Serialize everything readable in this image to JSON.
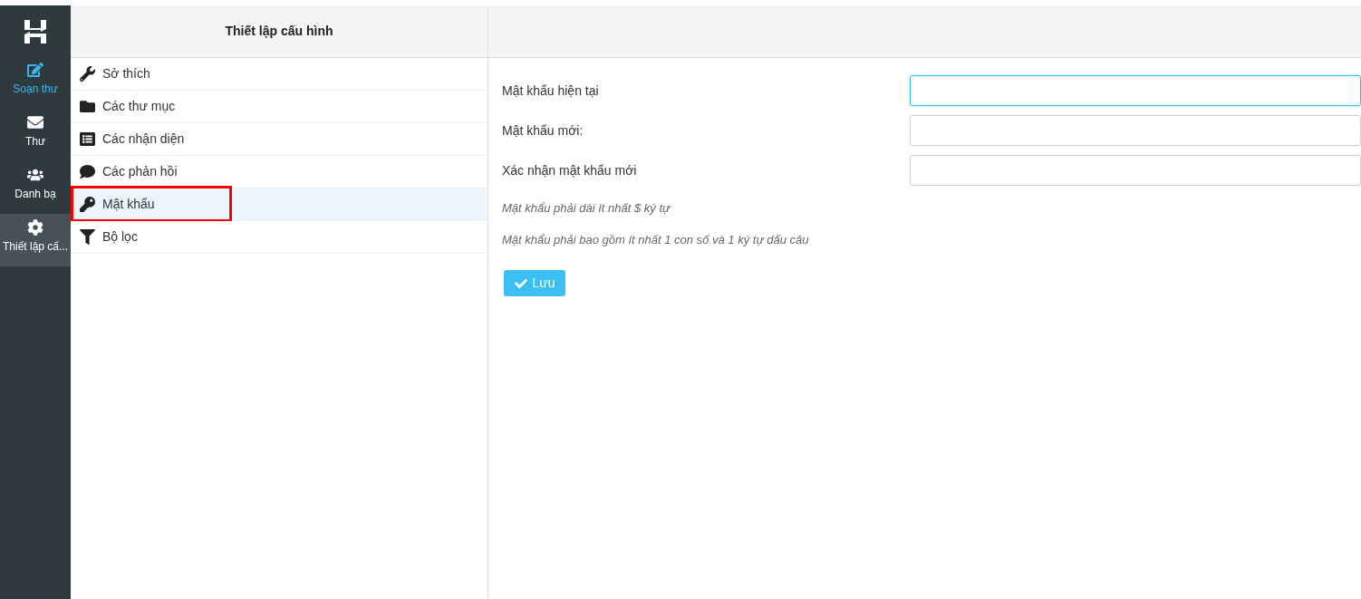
{
  "nav": [
    {
      "kind": "compose",
      "label": "Soạn thư",
      "accent": true,
      "selected": false
    },
    {
      "kind": "mail",
      "label": "Thư",
      "accent": false,
      "selected": false
    },
    {
      "kind": "contacts",
      "label": "Danh bạ",
      "accent": false,
      "selected": false
    },
    {
      "kind": "settings",
      "label": "Thiết lập cấ...",
      "accent": false,
      "selected": true
    }
  ],
  "settings": {
    "title": "Thiết lập cấu hình",
    "items": [
      {
        "kind": "wrench",
        "label": "Sở thích",
        "selected": false,
        "outlined": false
      },
      {
        "kind": "folder",
        "label": "Các thư mục",
        "selected": false,
        "outlined": false
      },
      {
        "kind": "list",
        "label": "Các nhận diện",
        "selected": false,
        "outlined": false
      },
      {
        "kind": "comment",
        "label": "Các phản hồi",
        "selected": false,
        "outlined": false
      },
      {
        "kind": "key",
        "label": "Mật khẩu",
        "selected": true,
        "outlined": true
      },
      {
        "kind": "filter",
        "label": "Bộ lọc",
        "selected": false,
        "outlined": false
      }
    ]
  },
  "form": {
    "fields": [
      {
        "label": "Mật khẩu hiện tại",
        "focused": true
      },
      {
        "label": "Mật khẩu mới:",
        "focused": false
      },
      {
        "label": "Xác nhận mật khẩu mới",
        "focused": false
      }
    ],
    "hints": [
      "Mật khẩu phải dài ít nhất $ ký tự",
      "Mật khẩu phải bao gồm ít nhất 1 con số và 1 ký tự dấu câu"
    ],
    "save_button": "Lưu"
  }
}
